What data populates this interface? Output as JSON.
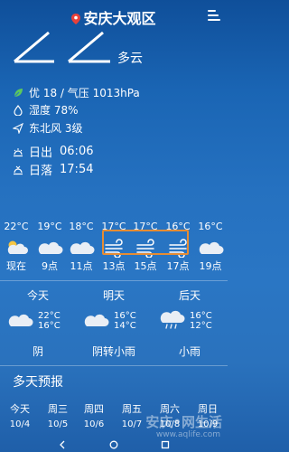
{
  "header": {
    "city": "安庆大观区"
  },
  "current": {
    "condition": "多云",
    "air": "优 18 / 气压 1013hPa",
    "humidity": "湿度 78%",
    "wind": "东北风 3级",
    "sunrise_label": "日出",
    "sunrise": "06:06",
    "sunset_label": "日落",
    "sunset": "17:54"
  },
  "hourly": [
    {
      "temp": "22°C",
      "label": "现在",
      "icon": "partly-cloudy-icon"
    },
    {
      "temp": "19°C",
      "label": "9点",
      "icon": "cloud-icon"
    },
    {
      "temp": "18°C",
      "label": "11点",
      "icon": "cloud-icon"
    },
    {
      "temp": "17°C",
      "label": "13点",
      "icon": "wind-icon"
    },
    {
      "temp": "17°C",
      "label": "15点",
      "icon": "wind-icon"
    },
    {
      "temp": "16°C",
      "label": "17点",
      "icon": "wind-icon"
    },
    {
      "temp": "16°C",
      "label": "19点",
      "icon": "cloud-icon"
    }
  ],
  "daily": [
    {
      "day": "今天",
      "high": "22°C",
      "low": "16°C",
      "desc": "阴",
      "icon": "cloud-icon"
    },
    {
      "day": "明天",
      "high": "16°C",
      "low": "14°C",
      "desc": "阴转小雨",
      "icon": "cloud-icon"
    },
    {
      "day": "后天",
      "high": "16°C",
      "low": "12°C",
      "desc": "小雨",
      "icon": "rain-cloud-icon"
    }
  ],
  "multi_day": {
    "title": "多天预报",
    "days": [
      {
        "weekday": "今天",
        "date": "10/4"
      },
      {
        "weekday": "周三",
        "date": "10/5"
      },
      {
        "weekday": "周四",
        "date": "10/6"
      },
      {
        "weekday": "周五",
        "date": "10/7"
      },
      {
        "weekday": "周六",
        "date": "10/8"
      },
      {
        "weekday": "周日",
        "date": "10/9"
      }
    ]
  },
  "watermark": {
    "text": "安庆•网生活",
    "url": "www.aqlife.com"
  },
  "colors": {
    "highlight_border": "#e58c34",
    "leaf": "#5cc85c",
    "sun": "#f5c542"
  }
}
